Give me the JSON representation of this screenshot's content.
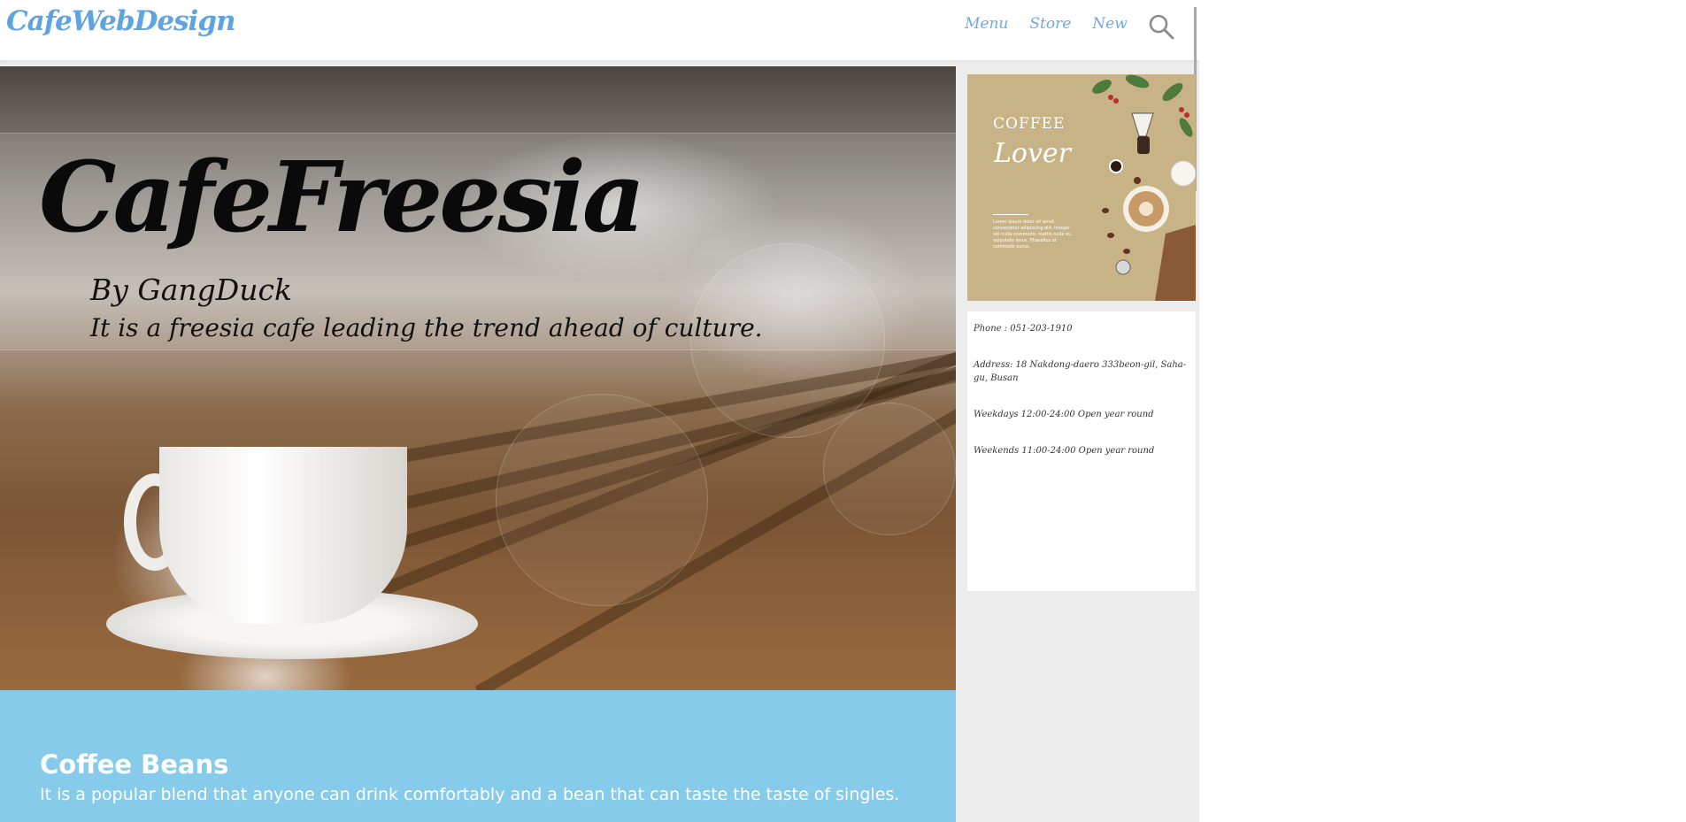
{
  "header": {
    "logo": "CafeWebDesign",
    "nav": [
      "Menu",
      "Store",
      "New"
    ]
  },
  "hero": {
    "title": "CafeFreesia",
    "by": "By GangDuck",
    "tagline": "It is a freesia cafe leading the trend ahead of culture."
  },
  "promo": {
    "heading": "COFFEE",
    "script": "Lover",
    "body": "Lorem ipsum dolor sit amet, consectetur adipiscing elit. Integer vel nulla commodo, mattis nulla eu, vulputate lacus. Phasellus at commodo purus."
  },
  "info": {
    "phone": "Phone : 051-203-1910",
    "address": "Address: 18 Nakdong-daero 333beon-gil, Saha-gu, Busan",
    "weekdays": "Weekdays 12:00-24:00 Open year round",
    "weekends": "Weekends 11:00-24:00 Open year round"
  },
  "beans": {
    "title": "Coffee Beans",
    "text": "It is a popular blend that anyone can drink comfortably and a bean that can taste the taste of singles."
  },
  "colors": {
    "accent": "#6fa9e2",
    "band": "#87cbea",
    "promo_bg": "#c8b387"
  }
}
